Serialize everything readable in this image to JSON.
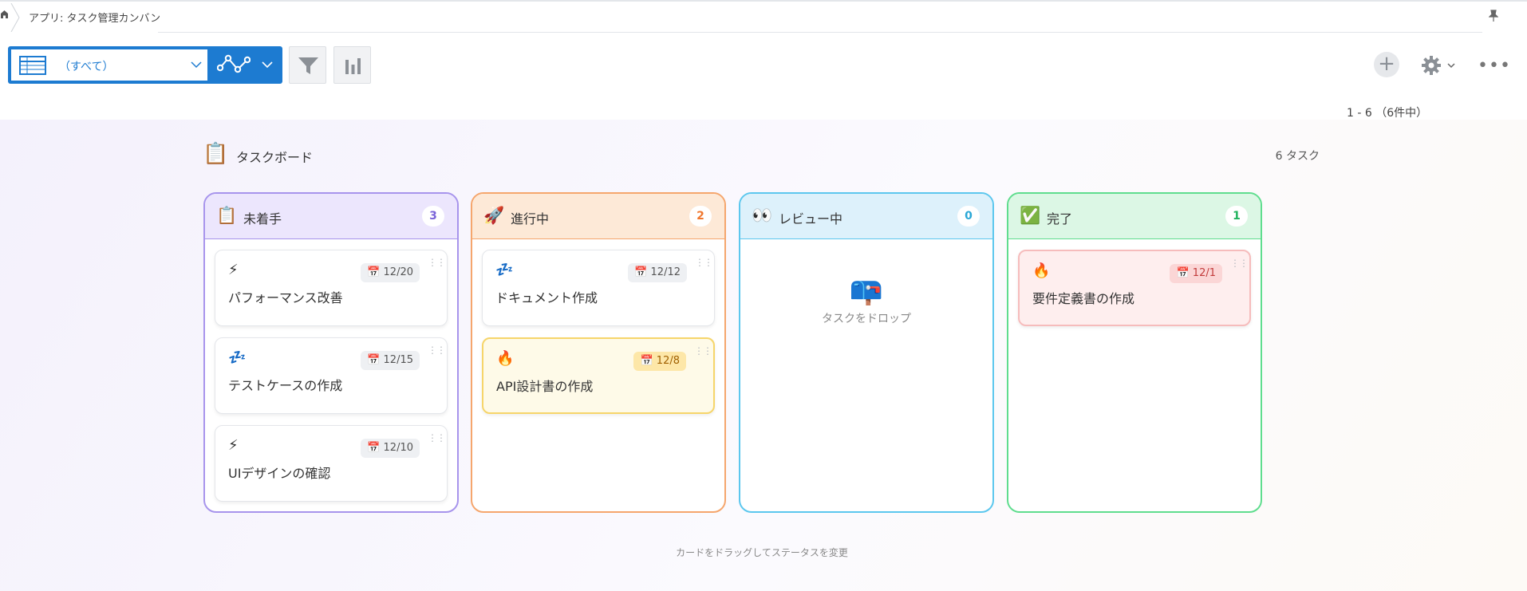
{
  "breadcrumb": {
    "home_icon": "home-icon",
    "app_label": "アプリ: タスク管理カンバン",
    "pin_icon": "pin-icon"
  },
  "toolbar": {
    "view_label": "（すべて）",
    "add_icon": "+",
    "more_icon": "•••"
  },
  "pager": "1 - 6 （6件中）",
  "board": {
    "icon": "📋",
    "title": "タスクボード",
    "task_count": "6 タスク",
    "columns": [
      {
        "emoji": "📋",
        "title": "未着手",
        "count": "3",
        "border": "#a794ec",
        "head_bg": "#ece6fd",
        "badge_color": "#7a63d8",
        "cards": [
          {
            "emoji": "⚡",
            "date": "📅 12/20",
            "title": "パフォーマンス改善"
          },
          {
            "emoji": "💤",
            "date": "📅 12/15",
            "title": "テストケースの作成"
          },
          {
            "emoji": "⚡",
            "date": "📅 12/10",
            "title": "UIデザインの確認"
          }
        ]
      },
      {
        "emoji": "🚀",
        "title": "進行中",
        "count": "2",
        "border": "#f5a66d",
        "head_bg": "#fde9d7",
        "badge_color": "#f0772e",
        "cards": [
          {
            "emoji": "💤",
            "date": "📅 12/12",
            "title": "ドキュメント作成"
          },
          {
            "emoji": "🔥",
            "date": "📅 12/8",
            "title": "API設計書の作成"
          }
        ]
      },
      {
        "emoji": "👀",
        "title": "レビュー中",
        "count": "0",
        "border": "#5cc7ee",
        "head_bg": "#ddf1fb",
        "badge_color": "#2aa7d6",
        "drop_emoji": "📪",
        "drop_text": "タスクをドロップ"
      },
      {
        "emoji": "✅",
        "title": "完了",
        "count": "1",
        "border": "#5fdd8e",
        "head_bg": "#dcf7e5",
        "badge_color": "#22b35e",
        "cards": [
          {
            "emoji": "🔥",
            "date": "📅 12/1",
            "title": "要件定義書の作成"
          }
        ]
      }
    ]
  },
  "footer_hint": "カードをドラッグしてステータスを変更",
  "card_handle": "⋮⋮"
}
